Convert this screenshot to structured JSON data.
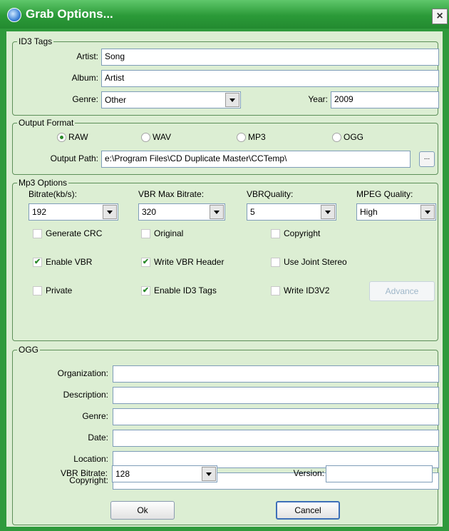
{
  "window": {
    "title": "Grab Options...",
    "close_glyph": "×"
  },
  "id3": {
    "legend": "ID3 Tags",
    "artist_label": "Artist:",
    "artist_value": "Song",
    "album_label": "Album:",
    "album_value": "Artist",
    "genre_label": "Genre:",
    "genre_value": "Other",
    "year_label": "Year:",
    "year_value": "2009"
  },
  "output": {
    "legend": "Output Format",
    "formats": [
      {
        "label": "RAW",
        "selected": true
      },
      {
        "label": "WAV",
        "selected": false
      },
      {
        "label": "MP3",
        "selected": false
      },
      {
        "label": "OGG",
        "selected": false
      }
    ],
    "path_label": "Output Path:",
    "path_value": "e:\\Program Files\\CD Duplicate Master\\CCTemp\\",
    "browse_label": "..."
  },
  "mp3": {
    "legend": "Mp3 Options",
    "bitrate_label": "Bitrate(kb/s):",
    "bitrate_value": "192",
    "vbr_max_label": "VBR Max Bitrate:",
    "vbr_max_value": "320",
    "vbr_quality_label": "VBRQuality:",
    "vbr_quality_value": "5",
    "mpeg_quality_label": "MPEG Quality:",
    "mpeg_quality_value": "High",
    "checkboxes": [
      {
        "label": "Generate CRC",
        "checked": false
      },
      {
        "label": "Original",
        "checked": false
      },
      {
        "label": "Copyright",
        "checked": false
      },
      {
        "label": "Enable VBR",
        "checked": true
      },
      {
        "label": "Write VBR Header",
        "checked": true
      },
      {
        "label": "Use Joint Stereo",
        "checked": false
      },
      {
        "label": "Private",
        "checked": false
      },
      {
        "label": "Enable ID3 Tags",
        "checked": true
      },
      {
        "label": "Write ID3V2",
        "checked": false
      }
    ],
    "advance_label": "Advance"
  },
  "ogg": {
    "legend": "OGG",
    "organization_label": "Organization:",
    "organization_value": "",
    "description_label": "Description:",
    "description_value": "",
    "genre_label": "Genre:",
    "genre_value": "",
    "date_label": "Date:",
    "date_value": "",
    "location_label": "Location:",
    "location_value": "",
    "copyright_label": "Copyright:",
    "copyright_value": "",
    "vbr_bitrate_label": "VBR Bitrate:",
    "vbr_bitrate_value": "128",
    "version_label": "Version:",
    "version_value": ""
  },
  "buttons": {
    "ok_label": "Ok",
    "cancel_label": "Cancel"
  },
  "colors": {
    "accent": "#2f9a3c",
    "client_bg": "#dceed3"
  },
  "icons": {
    "title": "app-disc-icon",
    "close": "close-icon",
    "combo_arrow": "chevron-down-icon"
  }
}
